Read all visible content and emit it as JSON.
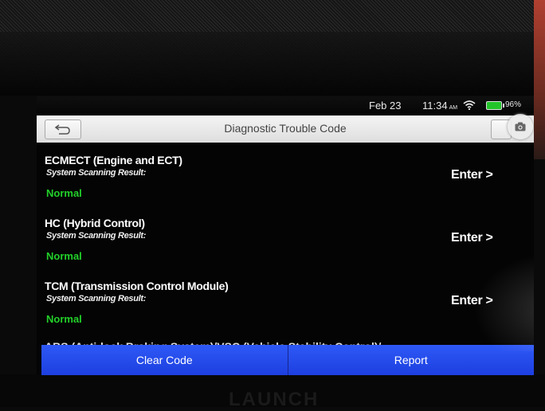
{
  "status_bar": {
    "date": "Feb 23",
    "time": "11:34",
    "ampm": "AM",
    "battery": "96%"
  },
  "header": {
    "title": "Diagnostic Trouble Code"
  },
  "systems": [
    {
      "name": "ECMECT (Engine and ECT)",
      "subtitle": "System Scanning Result:",
      "status": "Normal",
      "action": "Enter >"
    },
    {
      "name": "HC (Hybrid Control)",
      "subtitle": "System Scanning Result:",
      "status": "Normal",
      "action": "Enter >"
    },
    {
      "name": "TCM (Transmission Control Module)",
      "subtitle": "System Scanning Result:",
      "status": "Normal",
      "action": "Enter >"
    }
  ],
  "partial_item": "ABS (Anti-lock Braking System)/VSC (Vehicle Stability Control)/",
  "footer": {
    "clear_label": "Clear Code",
    "report_label": "Report"
  },
  "device_label": "LAUNCH",
  "colors": {
    "accent_blue": "#2e59f6",
    "status_green": "#22d02a",
    "battery_green": "#22c42a"
  }
}
